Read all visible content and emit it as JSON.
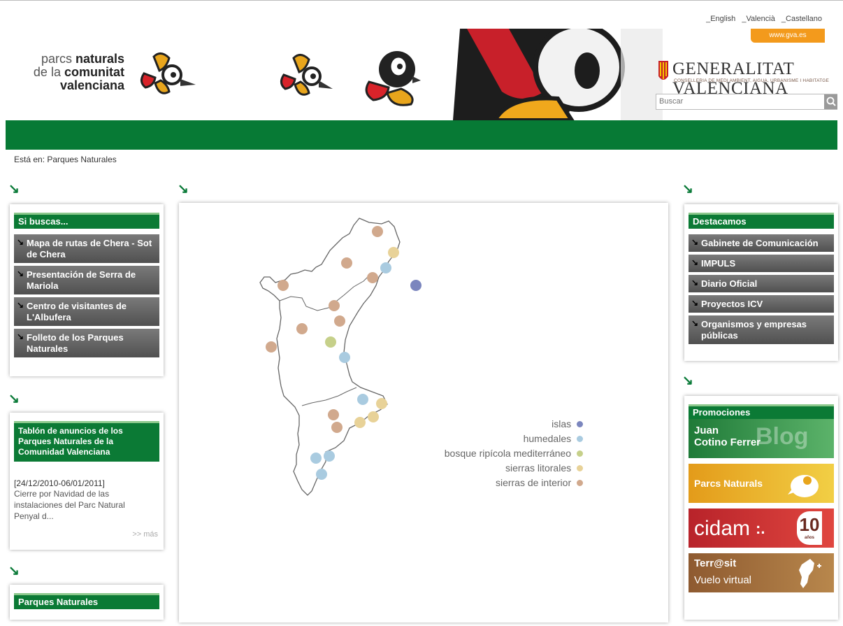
{
  "languages": [
    "_English",
    "_Valencià",
    "_Castellano"
  ],
  "header": {
    "logo_line1": "parcs",
    "logo_line1b": "naturals",
    "logo_line2": "de la",
    "logo_line2b": "comunitat",
    "logo_line3": "valenciana",
    "gva_link": "www.gva.es",
    "gv_name": "GENERALITAT VALENCIANA",
    "gv_sub": "CONSELLERIA DE MEDI AMBIENT, AIGUA, URBANISME I HABITATGE",
    "search_placeholder": "Buscar"
  },
  "breadcrumb": "Está en: Parques Naturales",
  "left": {
    "search_box_title": "Si buscas...",
    "links": [
      "Mapa de rutas de Chera - Sot de Chera",
      "Presentación de Serra de Mariola",
      "Centro de visitantes de L'Albufera",
      "Folleto de los Parques Naturales"
    ],
    "notice_title": "Tablón de anuncios de los Parques Naturales de la Comunidad Valenciana",
    "notice_date": "[24/12/2010-06/01/2011]",
    "notice_text": "Cierre por Navidad de las instalaciones del Parc Natural Penyal d...",
    "notice_more": ">> más",
    "parks_title": "Parques Naturales"
  },
  "map": {
    "legend": [
      {
        "label": "islas",
        "color": "#7b86be"
      },
      {
        "label": "humedales",
        "color": "#a9cbe0"
      },
      {
        "label": "bosque ripícola mediterráneo",
        "color": "#c6d08a"
      },
      {
        "label": "sierras litorales",
        "color": "#e8d298"
      },
      {
        "label": "sierras de interior",
        "color": "#d1a98d"
      }
    ]
  },
  "right": {
    "highlight_title": "Destacamos",
    "links": [
      "Gabinete de Comunicación",
      "IMPULS",
      "Diario Oficial",
      "Proyectos ICV",
      "Organismos y empresas públicas"
    ],
    "promo_title": "Promociones",
    "promos": [
      {
        "line1": "Juan",
        "line2": "Cotino Ferrer",
        "brand": "Blog gva",
        "color": "#2f9446"
      },
      {
        "line1": "Parcs Naturals",
        "color": "#e8b52a"
      },
      {
        "line1": "cidam",
        "badge": "10",
        "badge_sub": "años",
        "color": "#c8302c"
      },
      {
        "line1": "Terr@sit",
        "line2": "Vuelo virtual",
        "color": "#9a6a3c"
      }
    ]
  }
}
